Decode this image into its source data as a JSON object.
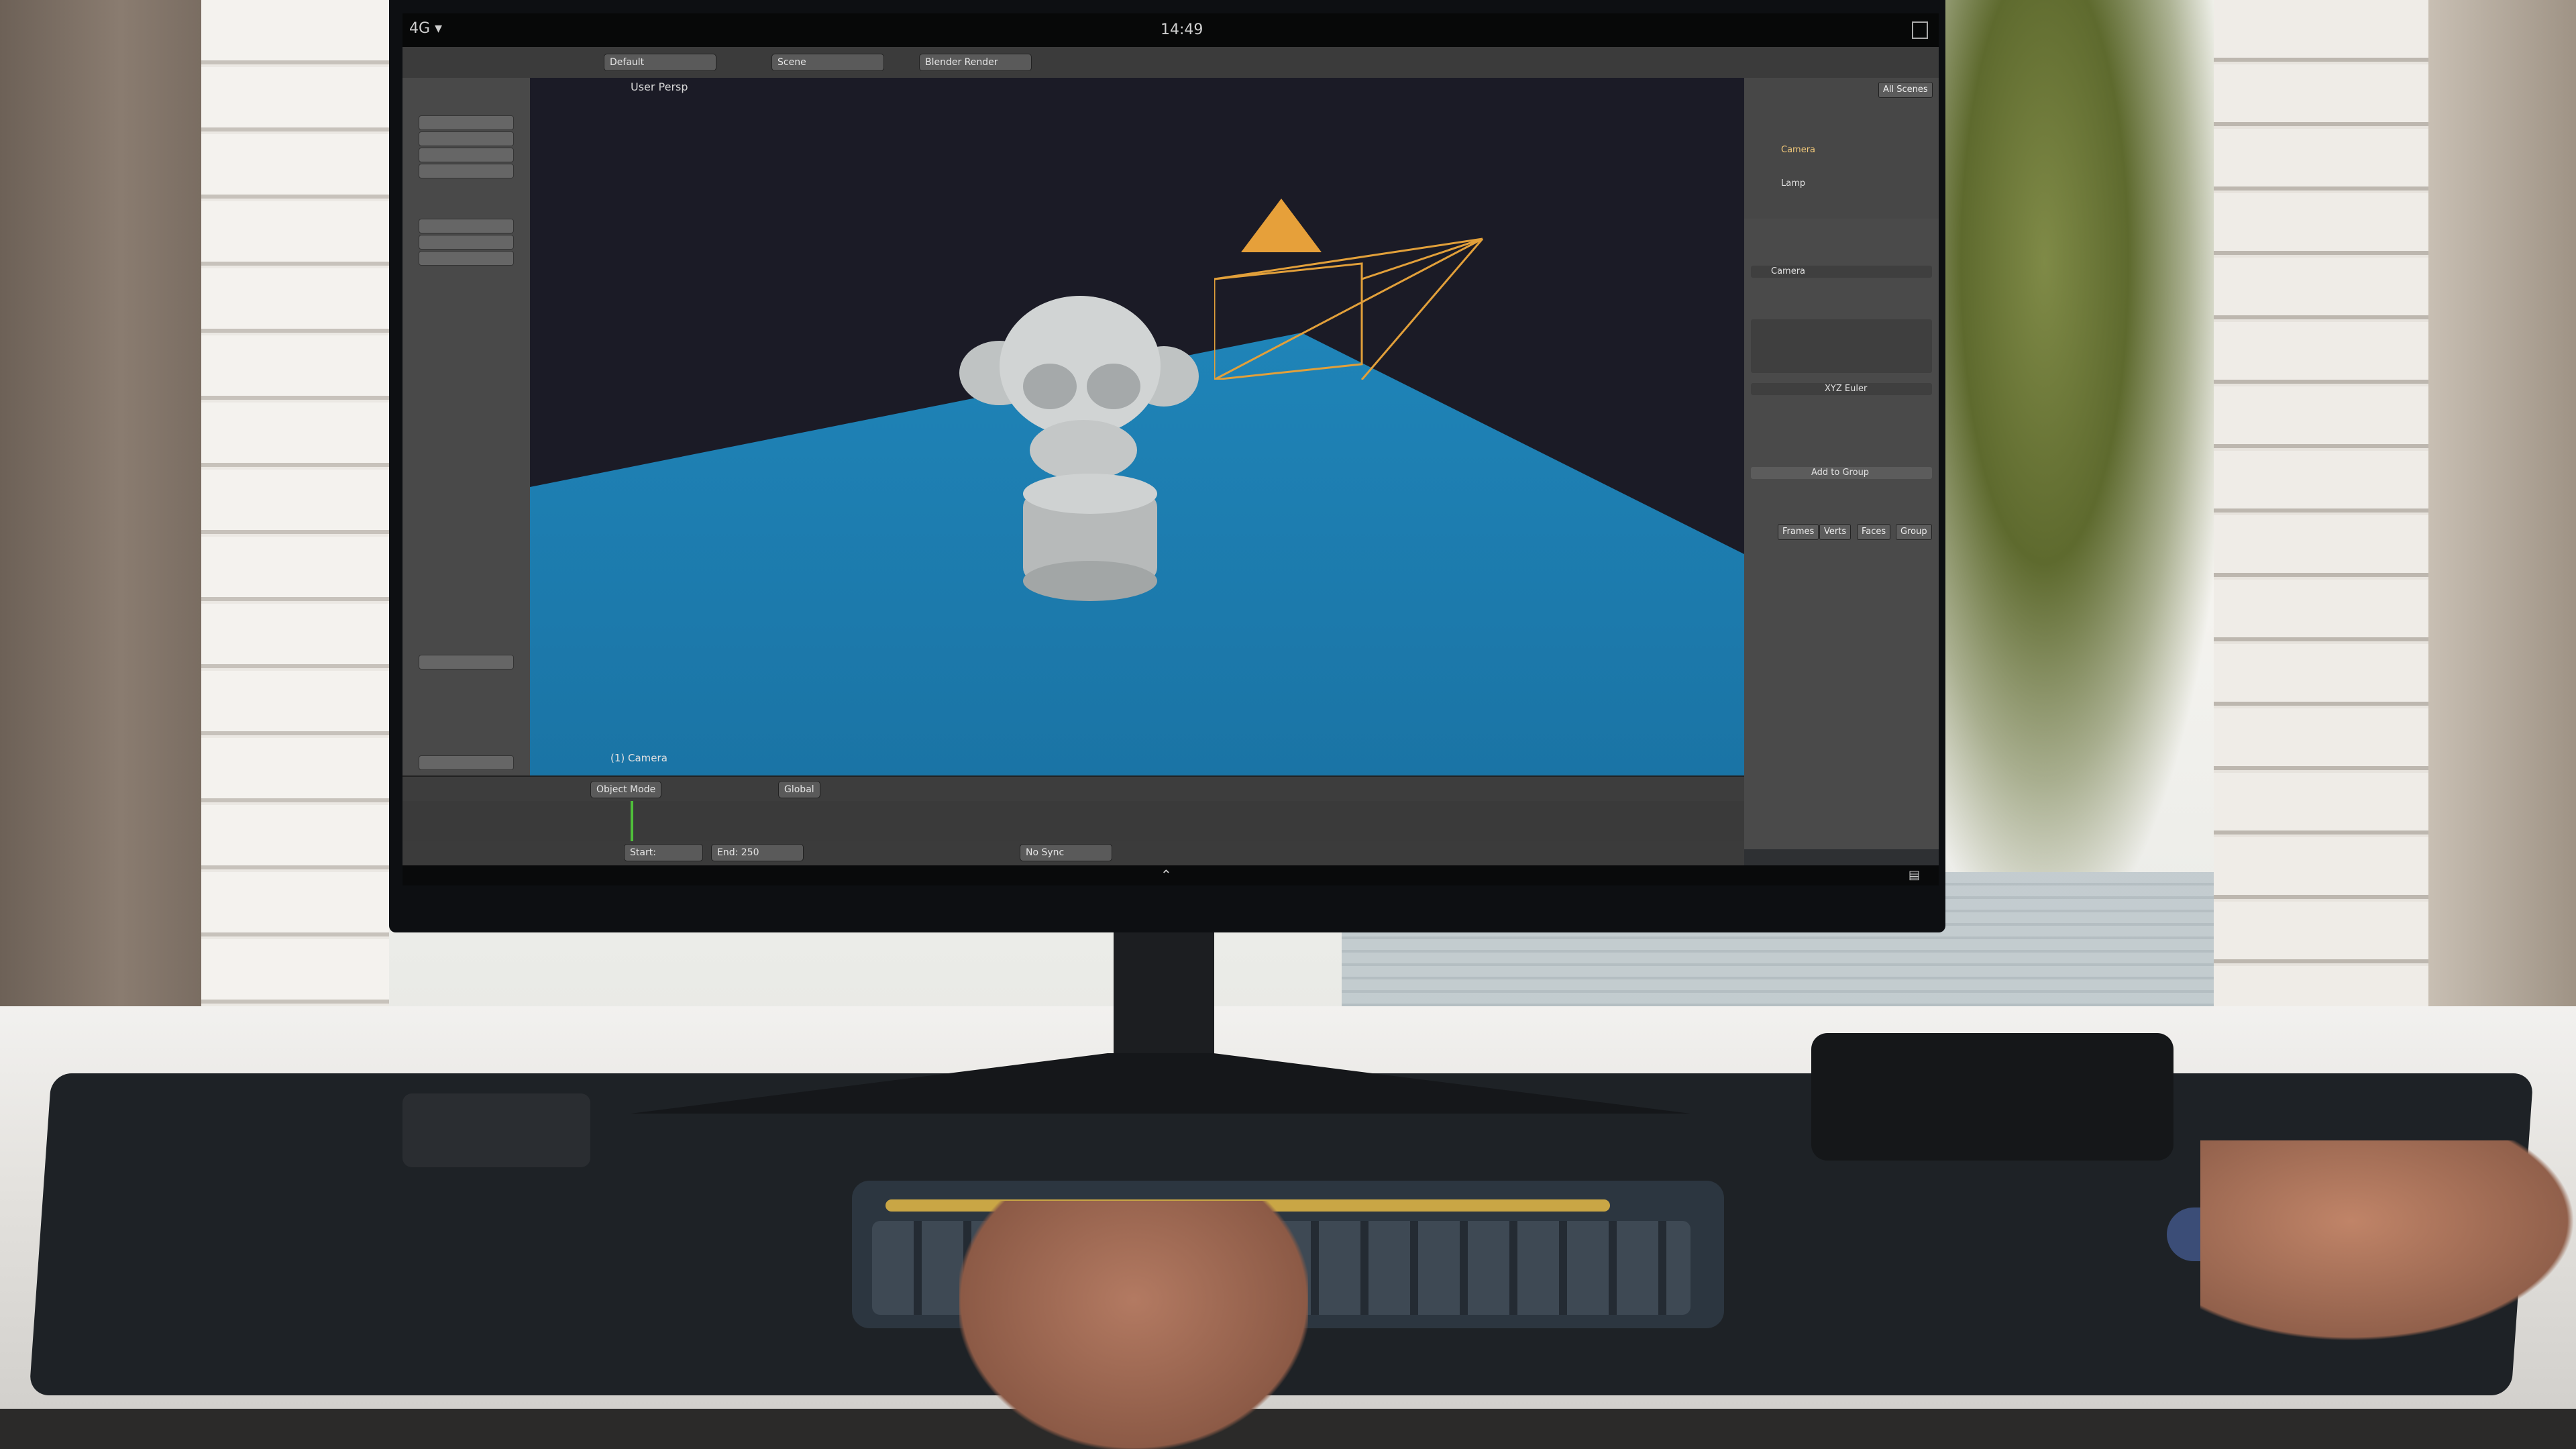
{
  "statusbar": {
    "time": "14:49",
    "signal": "4G"
  },
  "header": {
    "layout": "Default",
    "scene": "Scene",
    "renderer": "Blender Render"
  },
  "viewport": {
    "label": "User Persp",
    "object_label": "(1) Camera"
  },
  "view_header": {
    "mode": "Object Mode",
    "orientation": "Global"
  },
  "timeline_header": {
    "start": "Start:",
    "end": "End:",
    "end_value": "250",
    "sync": "No Sync"
  },
  "outliner": {
    "tab": "All Scenes",
    "items": [
      "Camera",
      "Lamp"
    ]
  },
  "properties": {
    "object_name": "Camera",
    "rotation_mode": "XYZ Euler",
    "add_group": "Add to Group",
    "tabs": [
      "Frames",
      "Verts",
      "Faces",
      "Group"
    ]
  },
  "icons": [
    "signal-icon",
    "menu-icon",
    "nav-up-icon",
    "grid-icon",
    "monkey-mesh",
    "camera-object"
  ]
}
